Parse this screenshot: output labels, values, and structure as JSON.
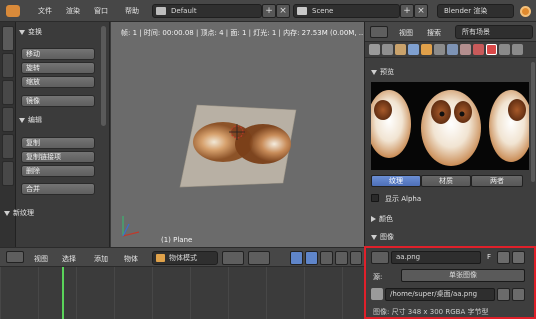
{
  "topbar": {
    "menus": [
      "文件",
      "渲染",
      "窗口",
      "帮助"
    ],
    "layout_field": "Default",
    "scene_field": "Scene",
    "engine_field": "Blender 渲染"
  },
  "left_panel": {
    "transform_header": "变换",
    "transform_buttons": [
      "移动",
      "旋转",
      "缩放",
      "镜像"
    ],
    "edit_header": "编辑",
    "edit_buttons": [
      "复制",
      "复制链接项",
      "删除",
      "合并"
    ],
    "new_texture_header": "新纹理"
  },
  "viewport": {
    "info": "帧: 1 | 时间: 00:00.08 | 顶点: 4 | 面: 1 | 灯光: 1 | 内存: 27.53M (0.00M, ...",
    "object_label": "(1) Plane"
  },
  "bottom_header": {
    "menus": [
      "视图",
      "选择",
      "添加",
      "物体"
    ],
    "mode": "物体模式"
  },
  "right_panel": {
    "header_items": [
      "视图",
      "搜索"
    ],
    "scene_filter": "所有场景",
    "preview_header": "预览",
    "preview_tabs": [
      "纹理",
      "材质",
      "两者"
    ],
    "show_alpha": "显示 Alpha",
    "color_header": "颜色",
    "image_header": "图像",
    "image_name": "aa.png",
    "image_flag": "F",
    "source_label": "源:",
    "source_value": "单张图像",
    "filepath": "/home/super/桌面/aa.png",
    "image_info": "图像: 尺寸 348 x 300 RGBA 字节型"
  }
}
